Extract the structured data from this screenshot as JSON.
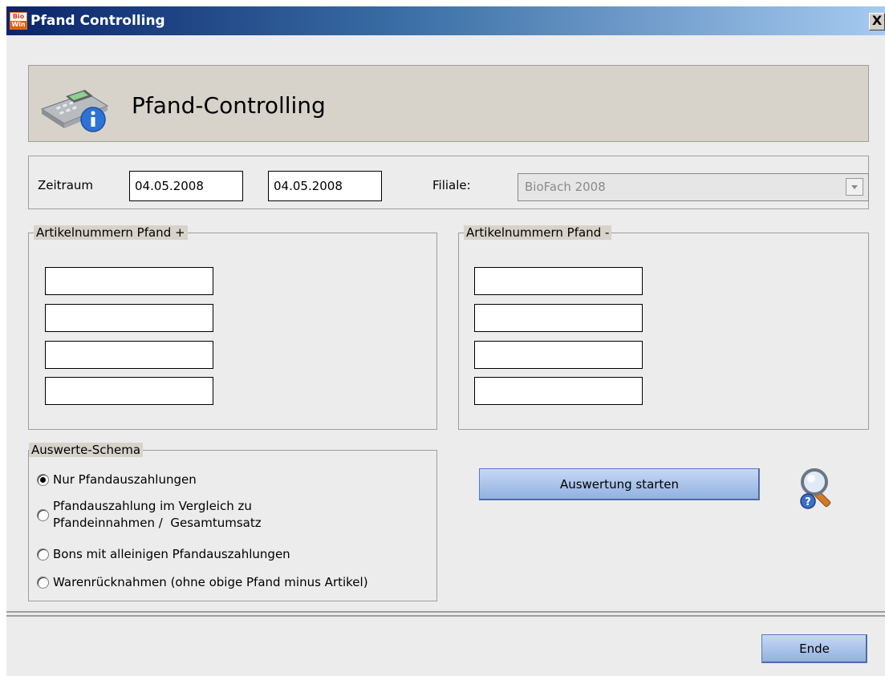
{
  "window": {
    "title": "Pfand Controlling",
    "icon_text_top": "Bio",
    "icon_text_bottom": "Win",
    "close_label": "X"
  },
  "header": {
    "title": "Pfand-Controlling",
    "icon": "cash-register-info-icon"
  },
  "range": {
    "label": "Zeitraum",
    "from": "04.05.2008",
    "to": "04.05.2008",
    "branch_label": "Filiale:",
    "branch_value": "BioFach 2008"
  },
  "plus_group": {
    "legend": "Artikelnummern Pfand +",
    "fields": [
      "",
      "",
      "",
      ""
    ]
  },
  "minus_group": {
    "legend": "Artikelnummern Pfand -",
    "fields": [
      "",
      "",
      "",
      ""
    ]
  },
  "schema": {
    "legend": "Auswerte-Schema",
    "options": [
      {
        "line1": "Nur Pfandauszahlungen",
        "line2": "",
        "checked": true
      },
      {
        "line1": "Pfandauszahlung im Vergleich zu",
        "line2": "Pfandeinnahmen /  Gesamtumsatz",
        "checked": false
      },
      {
        "line1": "Bons mit alleinigen Pfandauszahlungen",
        "line2": "",
        "checked": false
      },
      {
        "line1": "Warenrücknahmen (ohne obige Pfand minus Artikel)",
        "line2": "",
        "checked": false
      }
    ]
  },
  "actions": {
    "start_label": "Auswertung starten",
    "search_icon": "magnifier-help-icon",
    "end_label": "Ende"
  }
}
